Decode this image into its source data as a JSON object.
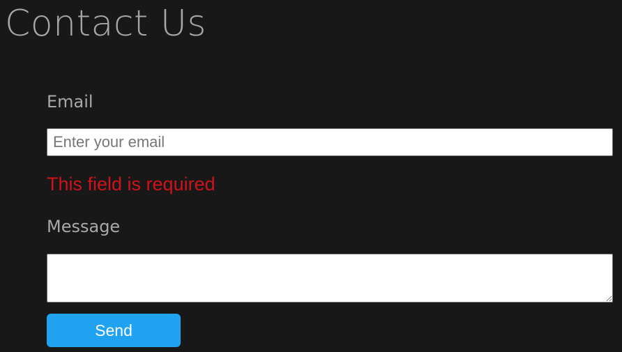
{
  "page": {
    "title": "Contact Us"
  },
  "form": {
    "email": {
      "label": "Email",
      "value": "",
      "placeholder": "Enter your email",
      "error": "This field is required"
    },
    "message": {
      "label": "Message",
      "value": ""
    },
    "submit": {
      "label": "Send"
    }
  },
  "colors": {
    "background": "#181818",
    "label_text": "#a9a9a9",
    "error": "#d0131a",
    "button": "#1fa3f0",
    "button_text": "#ffffff"
  }
}
